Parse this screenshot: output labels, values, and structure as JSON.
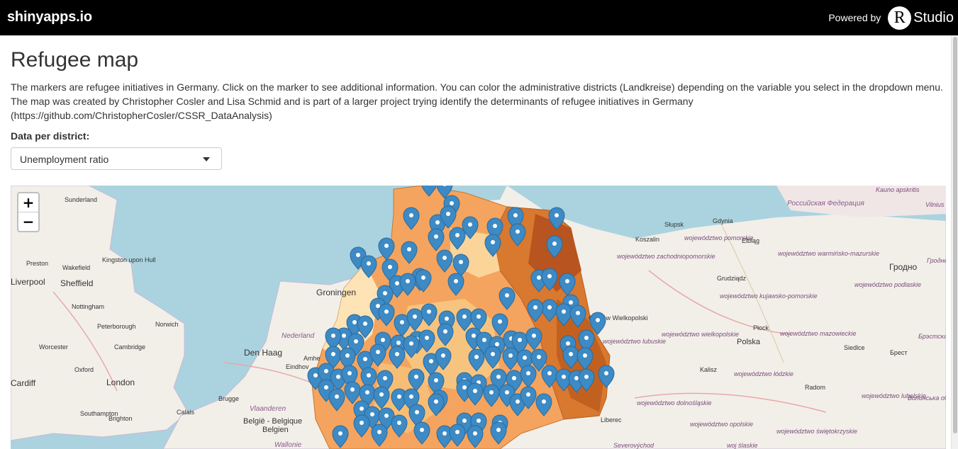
{
  "header": {
    "brand": "shinyapps.io",
    "powered_by": "Powered by",
    "logo_letter": "R",
    "logo_text": "Studio"
  },
  "page": {
    "title": "Refugee map",
    "description": "The markers are refugee initiatives in Germany. Click on the marker to see additional information. You can color the administrative districts (Landkreise) depending on the variable you select in the dropdown menu. The map was created by Christopher Cosler and Lisa Schmid and is part of a larger project trying identify the determinants of refugee initiatives in Germany (https://github.com/ChristopherCosler/CSSR_DataAnalysis)"
  },
  "control": {
    "label": "Data per district:",
    "selected": "Unemployment ratio"
  },
  "map": {
    "zoom_in": "+",
    "zoom_out": "−",
    "marker_color": "#3d8ac4",
    "icons": [
      "marker-icon"
    ],
    "labels": [
      "Sunderland",
      "Preston",
      "Kingston upon Hull",
      "Wakefield",
      "Liverpool",
      "Sheffield",
      "Nottingham",
      "Norwich",
      "Peterborough",
      "Worcester",
      "Cambridge",
      "Oxford",
      "Cardiff",
      "London",
      "Southampton",
      "Brighton",
      "Calais",
      "Den Haag",
      "Nederland",
      "Groningen",
      "Amhe",
      "Eindhov",
      "Brugge",
      "Vlaanderen",
      "België - Belgique",
      "Belgien",
      "Wallonie",
      "Kauno apskritis",
      "Vilnius ap",
      "Российская Федерация",
      "Słupsk",
      "Gdynia",
      "Koszalin",
      "województwo pomorskie",
      "Elbląg",
      "województwo warmińsko-mazurskie",
      "Гродно",
      "Гродненс облас",
      "województwo zachodniopomorskie",
      "Grudziądz",
      "województwo podlaskie",
      "województwo kujawsko-pomorskie",
      "Gorzów Wielkopolski",
      "Płock",
      "województwo wielkopolskie",
      "województwo lubuskie",
      "Polska",
      "województwo mazowieckie",
      "Siedlce",
      "Брест",
      "Брэстская",
      "Kalisz",
      "województwo łódzkie",
      "Radom",
      "województwo dolnośląskie",
      "Волинська обла",
      "województwo lubelskie",
      "Liberec",
      "województwo opolskie",
      "województwo świętokrzyskie",
      "Severovýchod",
      "woj ślaskie"
    ]
  }
}
